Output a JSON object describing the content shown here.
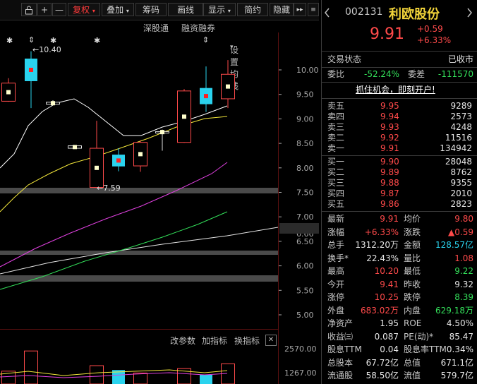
{
  "toolbar": {
    "items": [
      "",
      "+",
      "—",
      "复权",
      "叠加",
      "筹码",
      "画线",
      "显示",
      "简约",
      "隐藏"
    ],
    "nav_arrows": "▸▸"
  },
  "subbar": {
    "deep_stock": "深股通",
    "margin": "融资融券",
    "ma_settings": "设置均线"
  },
  "price_axis": [
    "10.00",
    "9.50",
    "9.00",
    "8.50",
    "8.00",
    "7.50",
    "7.00",
    "6.66",
    "6.50",
    "6.00",
    "5.50",
    "5.00"
  ],
  "annotations": {
    "high_label": "←10.40",
    "low_label": "←7.59",
    "star": "✱",
    "updown": "⇕"
  },
  "volume_bar": {
    "params": "改参数",
    "add_indicator": "加指标",
    "switch_indicator": "换指标",
    "close": "✕"
  },
  "volume_axis": [
    "2570.00",
    "1267.00"
  ],
  "colors": {
    "up": "#ff4a4a",
    "down": "#2ad3ee",
    "ma5": "#ffffff",
    "ma10": "#f2e63a",
    "ma20": "#e040e0",
    "ma30": "#33e05a",
    "ma60": "#d0d0d0"
  },
  "stock": {
    "code": "002131",
    "name": "利欧股份",
    "price": "9.91",
    "change": "+0.59",
    "change_pct": "+6.33%",
    "status_label": "交易状态",
    "status_value": "已收市",
    "weibi_label": "委比",
    "weibi_value": "-52.24%",
    "weicha_label": "委差",
    "weicha_value": "-111570",
    "promo": "抓住机会，即刻开户!"
  },
  "sell_orders": [
    {
      "label": "卖五",
      "price": "9.95",
      "volume": "9289"
    },
    {
      "label": "卖四",
      "price": "9.94",
      "volume": "2573"
    },
    {
      "label": "卖三",
      "price": "9.93",
      "volume": "4248"
    },
    {
      "label": "卖二",
      "price": "9.92",
      "volume": "11516"
    },
    {
      "label": "卖一",
      "price": "9.91",
      "volume": "134942"
    }
  ],
  "buy_orders": [
    {
      "label": "买一",
      "price": "9.90",
      "volume": "28048"
    },
    {
      "label": "买二",
      "price": "9.89",
      "volume": "8762"
    },
    {
      "label": "买三",
      "price": "9.88",
      "volume": "9355"
    },
    {
      "label": "买四",
      "price": "9.87",
      "volume": "2010"
    },
    {
      "label": "买五",
      "price": "9.86",
      "volume": "2823"
    }
  ],
  "stats": [
    {
      "l1": "最新",
      "v1": "9.91",
      "c1": "red",
      "l2": "均价",
      "v2": "9.80",
      "c2": "red"
    },
    {
      "l1": "涨幅",
      "v1": "+6.33%",
      "c1": "red",
      "l2": "涨跌",
      "v2": "▲0.59",
      "c2": "red"
    },
    {
      "l1": "总手",
      "v1": "1312.20万",
      "c1": "white",
      "l2": "金额",
      "v2": "128.57亿",
      "c2": "cyan"
    },
    {
      "l1": "换手*",
      "v1": "22.43%",
      "c1": "white",
      "l2": "量比",
      "v2": "1.08",
      "c2": "red"
    },
    {
      "l1": "最高",
      "v1": "10.20",
      "c1": "red",
      "l2": "最低",
      "v2": "9.22",
      "c2": "green"
    },
    {
      "l1": "今开",
      "v1": "9.41",
      "c1": "red",
      "l2": "昨收",
      "v2": "9.32",
      "c2": "white"
    },
    {
      "l1": "涨停",
      "v1": "10.25",
      "c1": "red",
      "l2": "跌停",
      "v2": "8.39",
      "c2": "green"
    },
    {
      "l1": "外盘",
      "v1": "683.02万",
      "c1": "red",
      "l2": "内盘",
      "v2": "629.18万",
      "c2": "green"
    },
    {
      "l1": "净资产",
      "v1": "1.95",
      "c1": "white",
      "l2": "ROE",
      "v2": "4.50%",
      "c2": "white"
    },
    {
      "l1": "收益㈢",
      "v1": "0.087",
      "c1": "white",
      "l2": "PE(动)*",
      "v2": "85.47",
      "c2": "white"
    },
    {
      "l1": "股息TTM",
      "v1": "0.04",
      "c1": "white",
      "l2": "股息率TTM",
      "v2": "0.34%",
      "c2": "white"
    },
    {
      "l1": "总股本",
      "v1": "67.72亿",
      "c1": "white",
      "l2": "总值",
      "v2": "671.1亿",
      "c2": "white"
    },
    {
      "l1": "流通股",
      "v1": "58.50亿",
      "c1": "white",
      "l2": "流值",
      "v2": "579.7亿",
      "c2": "white"
    }
  ]
}
